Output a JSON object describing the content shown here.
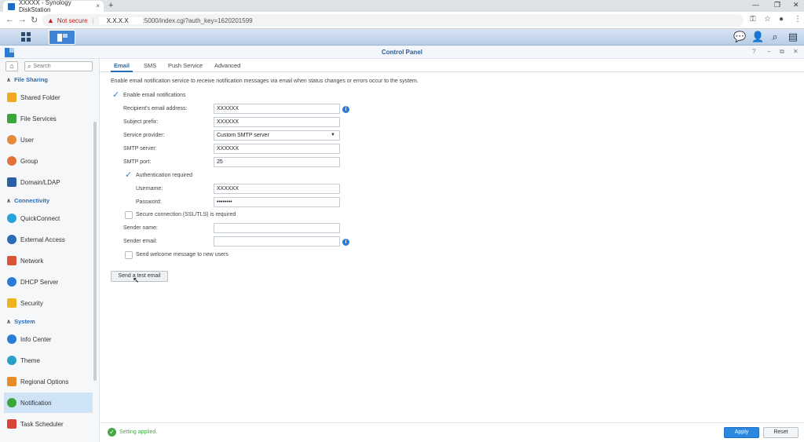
{
  "browser": {
    "tab_title": "XXXXX - Synology DiskStation",
    "tab_close": "×",
    "new_tab": "+",
    "not_secure": "Not secure",
    "url_host": "X.X.X.X",
    "url_rest": ":5000/index.cgi?auth_key=1620201599",
    "win_minimize": "—",
    "win_restore": "❐",
    "win_close": "✕"
  },
  "window": {
    "title": "Control Panel",
    "help": "?",
    "minimize": "–",
    "maximize": "⧉",
    "close": "✕"
  },
  "sidebar": {
    "search_placeholder": "Search",
    "sections": [
      {
        "label": "File Sharing"
      },
      {
        "label": "Connectivity"
      },
      {
        "label": "System"
      }
    ],
    "items": [
      {
        "label": "Shared Folder",
        "color": "#f0a81f"
      },
      {
        "label": "File Services",
        "color": "#3aa63a"
      },
      {
        "label": "User",
        "color": "#e58a3a"
      },
      {
        "label": "Group",
        "color": "#e2703a"
      },
      {
        "label": "Domain/LDAP",
        "color": "#2b5fa8"
      },
      {
        "label": "QuickConnect",
        "color": "#29a2d8"
      },
      {
        "label": "External Access",
        "color": "#2b6bb8"
      },
      {
        "label": "Network",
        "color": "#d8553a"
      },
      {
        "label": "DHCP Server",
        "color": "#2b7bd6"
      },
      {
        "label": "Security",
        "color": "#f0b21f"
      },
      {
        "label": "Info Center",
        "color": "#2b7bd6"
      },
      {
        "label": "Theme",
        "color": "#2aa0c8"
      },
      {
        "label": "Regional Options",
        "color": "#e88b2a"
      },
      {
        "label": "Notification",
        "color": "#3aa63a"
      },
      {
        "label": "Task Scheduler",
        "color": "#d8453a"
      }
    ]
  },
  "tabs": [
    {
      "label": "Email"
    },
    {
      "label": "SMS"
    },
    {
      "label": "Push Service"
    },
    {
      "label": "Advanced"
    }
  ],
  "email": {
    "description": "Enable email notification service to receive notification messages via email when status changes or errors occur to the system.",
    "enable_label": "Enable email notifications",
    "enable_checked": true,
    "recipient_label": "Recipient's email address:",
    "recipient_value": "XXXXXX",
    "subject_label": "Subject prefix:",
    "subject_value": "XXXXXX",
    "provider_label": "Service provider:",
    "provider_value": "Custom SMTP server",
    "smtp_server_label": "SMTP server:",
    "smtp_server_value": "XXXXXX",
    "smtp_port_label": "SMTP port:",
    "smtp_port_value": "25",
    "auth_label": "Authentication required",
    "auth_checked": true,
    "username_label": "Username:",
    "username_value": "XXXXXX",
    "password_label": "Password:",
    "password_value": "••••••••",
    "ssl_label": "Secure connection (SSL/TLS) is required",
    "sender_name_label": "Sender name:",
    "sender_name_value": "",
    "sender_email_label": "Sender email:",
    "sender_email_value": "",
    "welcome_label": "Send welcome message to new users",
    "test_button": "Send a test email"
  },
  "footer": {
    "status": "Setting applied.",
    "apply": "Apply",
    "reset": "Reset"
  }
}
